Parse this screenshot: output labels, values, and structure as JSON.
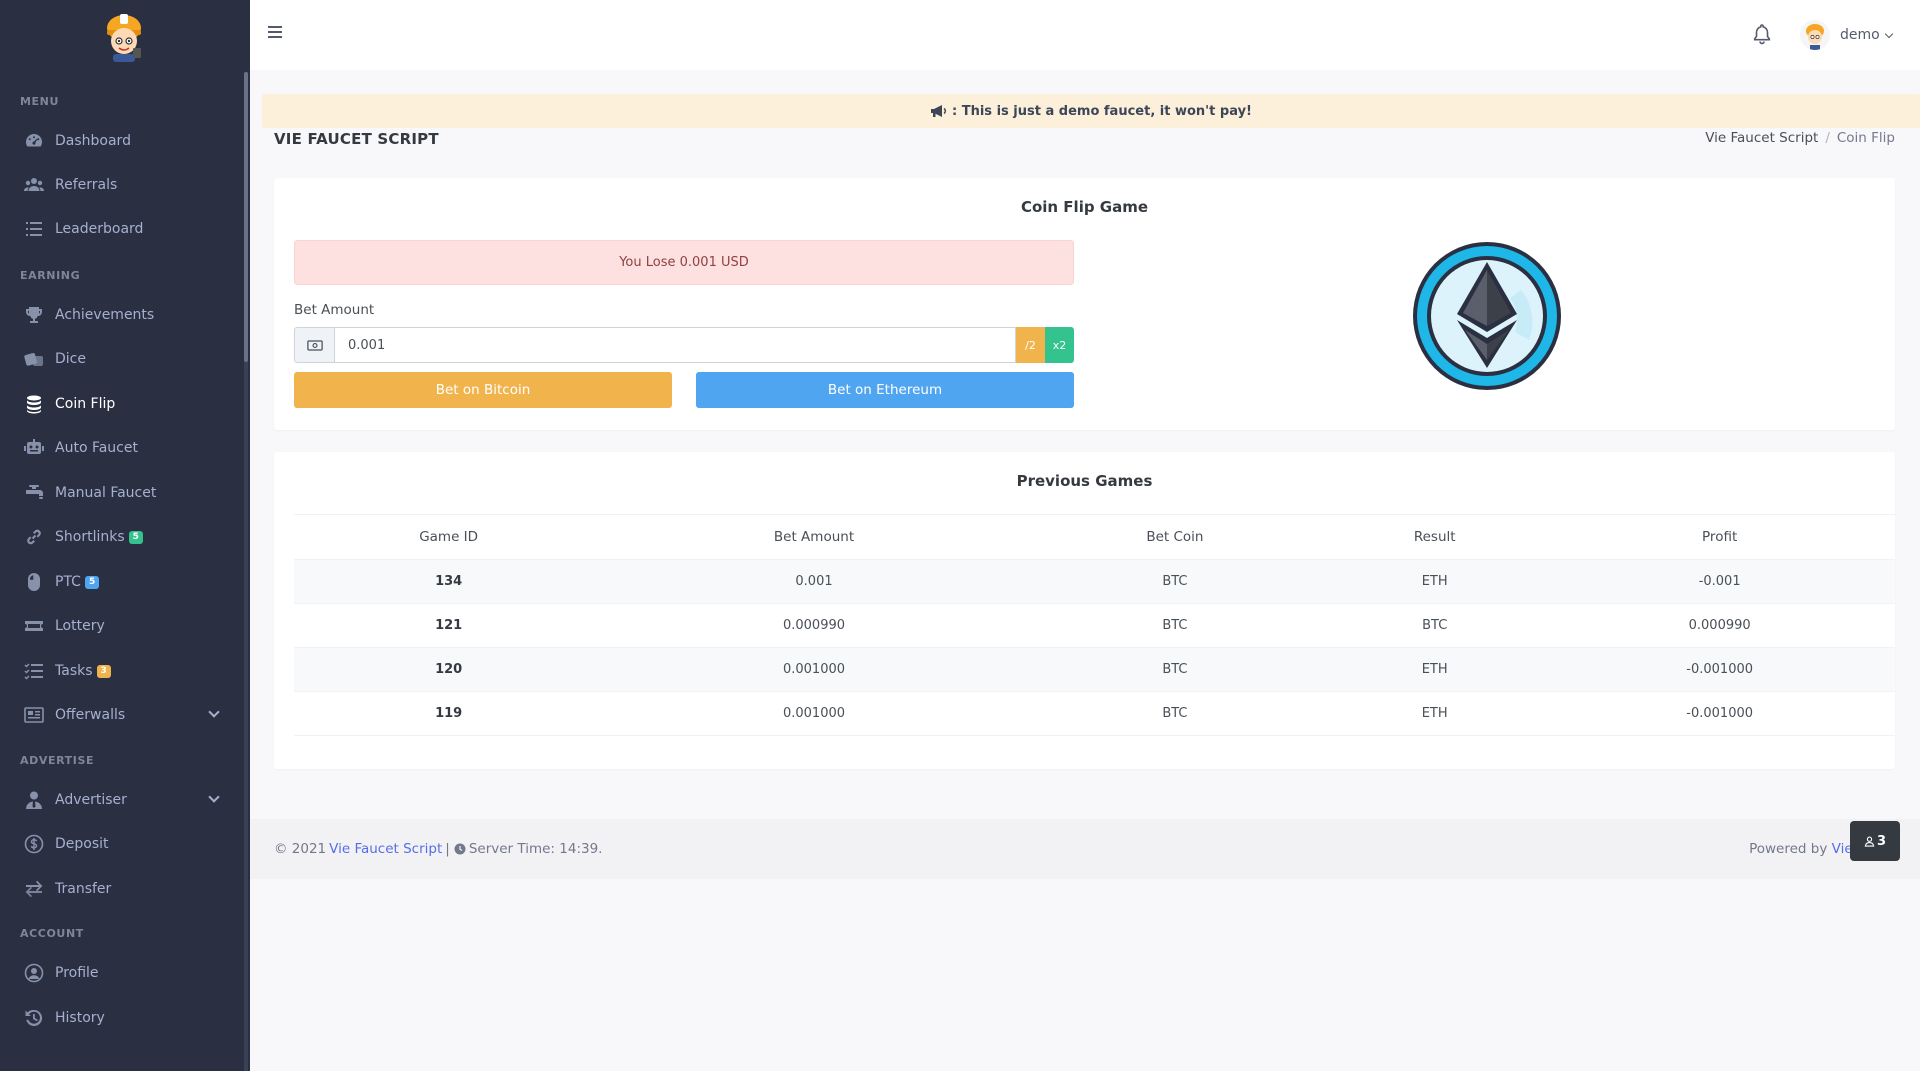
{
  "sidebar": {
    "sections": {
      "menu": "MENU",
      "earning": "EARNING",
      "advertise": "ADVERTISE",
      "account": "ACCOUNT"
    },
    "items": {
      "dashboard": "Dashboard",
      "referrals": "Referrals",
      "leaderboard": "Leaderboard",
      "achievements": "Achievements",
      "dice": "Dice",
      "coinflip": "Coin Flip",
      "autofaucet": "Auto Faucet",
      "manualfaucet": "Manual Faucet",
      "shortlinks": "Shortlinks",
      "ptc": "PTC",
      "lottery": "Lottery",
      "tasks": "Tasks",
      "offerwalls": "Offerwalls",
      "advertiser": "Advertiser",
      "deposit": "Deposit",
      "transfer": "Transfer",
      "profile": "Profile",
      "history": "History"
    },
    "badges": {
      "shortlinks": "5",
      "ptc": "5",
      "tasks": "3"
    },
    "active_item": "coinflip"
  },
  "topbar": {
    "username": "demo",
    "icons": [
      "hamburger-icon",
      "bell-icon",
      "chevron-down-icon"
    ]
  },
  "notice": {
    "text": ": This is just a demo faucet, it won't pay!",
    "icon": "megaphone-icon"
  },
  "page": {
    "title": "VIE FAUCET SCRIPT",
    "breadcrumb": [
      "Vie Faucet Script",
      "Coin Flip"
    ]
  },
  "game": {
    "title": "Coin Flip Game",
    "result_message": "You Lose 0.001 USD",
    "bet_label": "Bet Amount",
    "bet_value": "0.001",
    "half_label": "/2",
    "double_label": "x2",
    "bet_bitcoin_label": "Bet on Bitcoin",
    "bet_ethereum_label": "Bet on Ethereum",
    "coin_icon": "ethereum-coin-icon"
  },
  "history": {
    "title": "Previous Games",
    "columns": [
      "Game ID",
      "Bet Amount",
      "Bet Coin",
      "Result",
      "Profit"
    ],
    "rows": [
      [
        "134",
        "0.001",
        "BTC",
        "ETH",
        "-0.001"
      ],
      [
        "121",
        "0.000990",
        "BTC",
        "BTC",
        "0.000990"
      ],
      [
        "120",
        "0.001000",
        "BTC",
        "ETH",
        "-0.001000"
      ],
      [
        "119",
        "0.001000",
        "BTC",
        "ETH",
        "-0.001000"
      ]
    ]
  },
  "footer": {
    "copyright": "© 2021",
    "site_link": "Vie Faucet Script",
    "separator": "|",
    "server_time": "Server Time: 14:39.",
    "powered_by": "Powered by",
    "powered_link": "Vie Fauce",
    "online_count": "3"
  },
  "colors": {
    "sidebar_bg": "#2a3042",
    "warning": "#f1b44c",
    "info": "#50a5f1",
    "success": "#34c38f",
    "danger_bg": "#fde1e1",
    "link": "#556ee6"
  }
}
